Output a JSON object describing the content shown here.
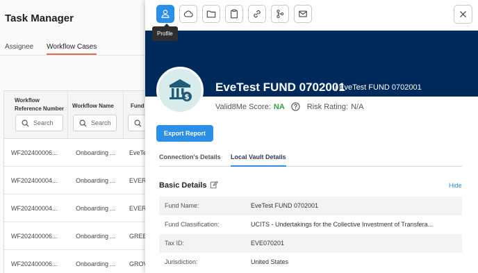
{
  "background": {
    "title": "Task Manager",
    "tabs": [
      {
        "label": "Assignee"
      },
      {
        "label": "Workflow Cases"
      }
    ],
    "table": {
      "headers": [
        "Workflow Reference Number",
        "Workflow Name",
        "Fund"
      ],
      "search_placeholder": "Search",
      "rows": [
        {
          "ref": "WF202400006...",
          "name": "Onboarding ...",
          "fund": "EveTe"
        },
        {
          "ref": "WF202400004...",
          "name": "Onboarding ...",
          "fund": "EVER"
        },
        {
          "ref": "WF202400004...",
          "name": "Onboarding ...",
          "fund": "EVER"
        },
        {
          "ref": "WF202400006...",
          "name": "Onboarding ...",
          "fund": "GREE"
        },
        {
          "ref": "WF202400006...",
          "name": "Onboarding ...",
          "fund": "GROV"
        }
      ]
    }
  },
  "panel": {
    "toolbar": {
      "buttons": [
        {
          "icon": "user-icon",
          "active": true
        },
        {
          "icon": "cloud-icon"
        },
        {
          "icon": "folder-icon"
        },
        {
          "icon": "clipboard-icon"
        },
        {
          "icon": "link-icon"
        },
        {
          "icon": "workflow-icon"
        },
        {
          "icon": "mail-icon"
        }
      ],
      "tooltip": "Profile",
      "close_icon": "close-icon"
    },
    "header": {
      "fund_name": "EveTest FUND 0702001",
      "fund_subtitle": "/ EveTest FUND 0702001",
      "score_label": "Valid8Me Score:",
      "score_value": "NA",
      "risk_label": "Risk Rating:",
      "risk_value": "N/A"
    },
    "export_label": "Export Report",
    "tabs": [
      {
        "label": "Connection's Details"
      },
      {
        "label": "Local Vault Details",
        "active": true
      }
    ],
    "section": {
      "title": "Basic Details",
      "hide_label": "Hide",
      "rows": [
        {
          "label": "Fund Name:",
          "value": "EveTest FUND 0702001"
        },
        {
          "label": "Fund Classification:",
          "value": "UCITS - Undertakings for the Collective Investment of Transfera..."
        },
        {
          "label": "Tax ID:",
          "value": "EVE070201"
        },
        {
          "label": "Jurisdiction:",
          "value": "United States"
        }
      ]
    }
  },
  "colors": {
    "accent": "#2b8fe8",
    "banner": "#002a5c",
    "score_green": "#29a745",
    "tab_underline": "#e06c4c"
  }
}
